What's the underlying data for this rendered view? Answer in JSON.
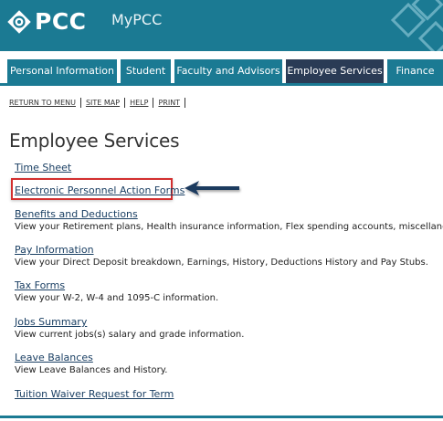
{
  "brand": {
    "logo_text": "PCC",
    "app_name": "MyPCC"
  },
  "tabs": [
    {
      "label": "Personal Information",
      "active": false
    },
    {
      "label": "Student",
      "active": false
    },
    {
      "label": "Faculty and Advisors",
      "active": false
    },
    {
      "label": "Employee Services",
      "active": true
    },
    {
      "label": "Finance",
      "active": false
    }
  ],
  "util_links": [
    "RETURN TO MENU",
    "SITE MAP",
    "HELP",
    "PRINT"
  ],
  "page_title": "Employee Services",
  "items": [
    {
      "label": "Time Sheet",
      "desc": ""
    },
    {
      "label": "Electronic Personnel Action Forms",
      "desc": "",
      "highlighted": true
    },
    {
      "label": "Benefits and Deductions",
      "desc": "View your Retirement plans, Health insurance information, Flex spending accounts, miscellaneo"
    },
    {
      "label": "Pay Information",
      "desc": "View your Direct Deposit breakdown, Earnings, History, Deductions History and Pay Stubs."
    },
    {
      "label": "Tax Forms",
      "desc": "View your W-2, W-4 and 1095-C information."
    },
    {
      "label": "Jobs Summary",
      "desc": "View current jobs(s) salary and grade information."
    },
    {
      "label": "Leave Balances",
      "desc": "View Leave Balances and History."
    },
    {
      "label": "Tuition Waiver Request for Term",
      "desc": ""
    }
  ],
  "colors": {
    "header_bg": "#1b7a93",
    "active_tab_bg": "#2a3b55",
    "link": "#1a3f63",
    "highlight_border": "#d32f2f",
    "arrow": "#1f3a5f"
  },
  "icons": {
    "logo": "pcc-logo-icon",
    "arrow": "left-arrow-icon"
  }
}
